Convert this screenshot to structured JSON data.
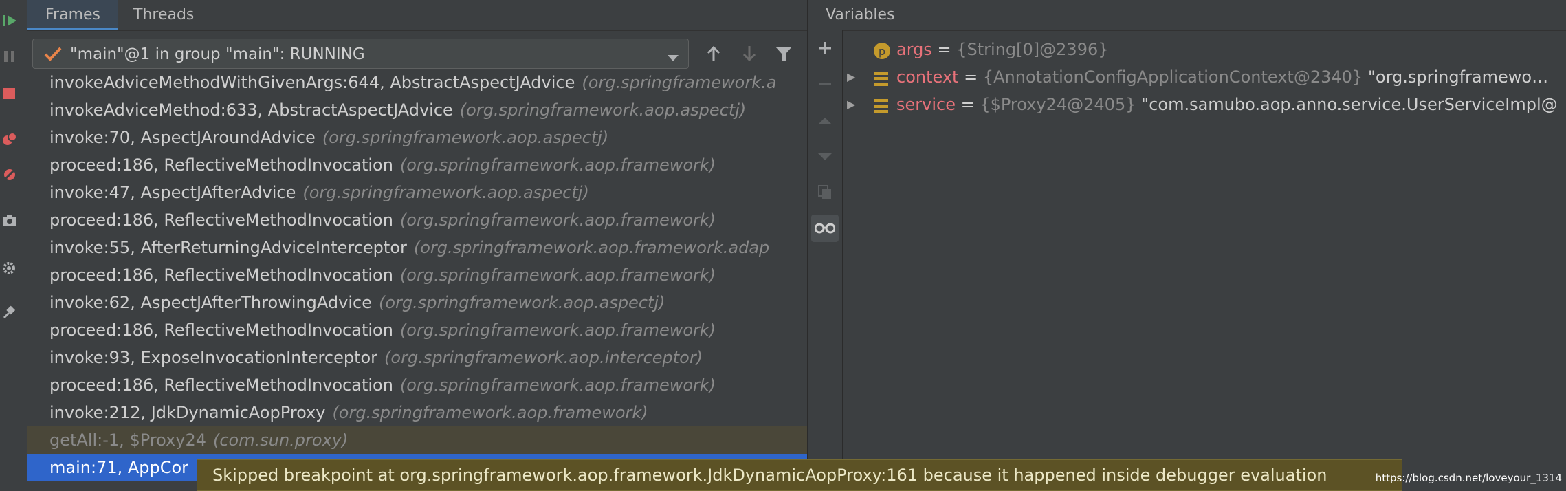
{
  "tabs": {
    "frames": "Frames",
    "threads": "Threads",
    "variables": "Variables"
  },
  "thread_selector": {
    "value": "\"main\"@1 in group \"main\": RUNNING"
  },
  "frames": [
    {
      "method": "invokeAdviceMethodWithGivenArgs:644, AbstractAspectJAdvice",
      "pkg": "(org.springframework.a",
      "state": "normal"
    },
    {
      "method": "invokeAdviceMethod:633, AbstractAspectJAdvice",
      "pkg": "(org.springframework.aop.aspectj)",
      "state": "normal"
    },
    {
      "method": "invoke:70, AspectJAroundAdvice",
      "pkg": "(org.springframework.aop.aspectj)",
      "state": "normal"
    },
    {
      "method": "proceed:186, ReflectiveMethodInvocation",
      "pkg": "(org.springframework.aop.framework)",
      "state": "normal"
    },
    {
      "method": "invoke:47, AspectJAfterAdvice",
      "pkg": "(org.springframework.aop.aspectj)",
      "state": "normal"
    },
    {
      "method": "proceed:186, ReflectiveMethodInvocation",
      "pkg": "(org.springframework.aop.framework)",
      "state": "normal"
    },
    {
      "method": "invoke:55, AfterReturningAdviceInterceptor",
      "pkg": "(org.springframework.aop.framework.adap",
      "state": "normal"
    },
    {
      "method": "proceed:186, ReflectiveMethodInvocation",
      "pkg": "(org.springframework.aop.framework)",
      "state": "normal"
    },
    {
      "method": "invoke:62, AspectJAfterThrowingAdvice",
      "pkg": "(org.springframework.aop.aspectj)",
      "state": "normal"
    },
    {
      "method": "proceed:186, ReflectiveMethodInvocation",
      "pkg": "(org.springframework.aop.framework)",
      "state": "normal"
    },
    {
      "method": "invoke:93, ExposeInvocationInterceptor",
      "pkg": "(org.springframework.aop.interceptor)",
      "state": "normal"
    },
    {
      "method": "proceed:186, ReflectiveMethodInvocation",
      "pkg": "(org.springframework.aop.framework)",
      "state": "normal"
    },
    {
      "method": "invoke:212, JdkDynamicAopProxy",
      "pkg": "(org.springframework.aop.framework)",
      "state": "normal"
    },
    {
      "method": "getAll:-1, $Proxy24",
      "pkg": "(com.sun.proxy)",
      "state": "dim"
    },
    {
      "method": "main:71, AppCor",
      "pkg": "",
      "state": "selected"
    }
  ],
  "variables": [
    {
      "name": "args",
      "type": "{String[0]@2396}",
      "value": "",
      "icon": "p-badge-icon",
      "expandable": false
    },
    {
      "name": "context",
      "type": "{AnnotationConfigApplicationContext@2340}",
      "value": "\"org.springframewo…",
      "icon": "field-icon",
      "expandable": true
    },
    {
      "name": "service",
      "type": "{$Proxy24@2405}",
      "value": "\"com.samubo.aop.anno.service.UserServiceImpl@",
      "icon": "field-icon",
      "expandable": true
    }
  ],
  "tooltip": "Skipped breakpoint at org.springframework.aop.framework.JdkDynamicAopProxy:161 because it happened inside debugger evaluation",
  "watermark": "https://blog.csdn.net/loveyour_1314",
  "colors": {
    "selected_row": "#2f65ca",
    "var_name": "#e8727a",
    "tooltip_bg": "#5c5225"
  }
}
